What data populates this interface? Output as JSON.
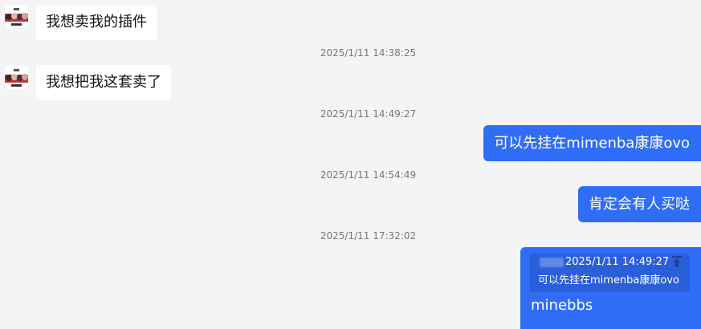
{
  "messages": [
    {
      "kind": "in",
      "text": "我想卖我的插件",
      "avatar_icon": "user-avatar-icon"
    },
    {
      "kind": "time",
      "text": "2025/1/11 14:38:25"
    },
    {
      "kind": "in",
      "text": "我想把我这套卖了",
      "avatar_icon": "user-avatar-icon"
    },
    {
      "kind": "time",
      "text": "2025/1/11 14:49:27"
    },
    {
      "kind": "out",
      "text": "可以先挂在mimenba康康ovo"
    },
    {
      "kind": "time",
      "text": "2025/1/11 14:54:49"
    },
    {
      "kind": "out",
      "text": "肯定会有人买哒"
    },
    {
      "kind": "time",
      "text": "2025/1/11 17:32:02"
    }
  ],
  "reply": {
    "quote_time": "2025/1/11 14:49:27",
    "quote_text": "可以先挂在mimenba康康ovo",
    "quote_icon": "jump-to-message-icon",
    "text": "minebbs"
  },
  "colors": {
    "background": "#f3f4f6",
    "outgoing_bubble": "#2f6df6",
    "incoming_bubble": "#ffffff",
    "timestamp": "#777777"
  }
}
